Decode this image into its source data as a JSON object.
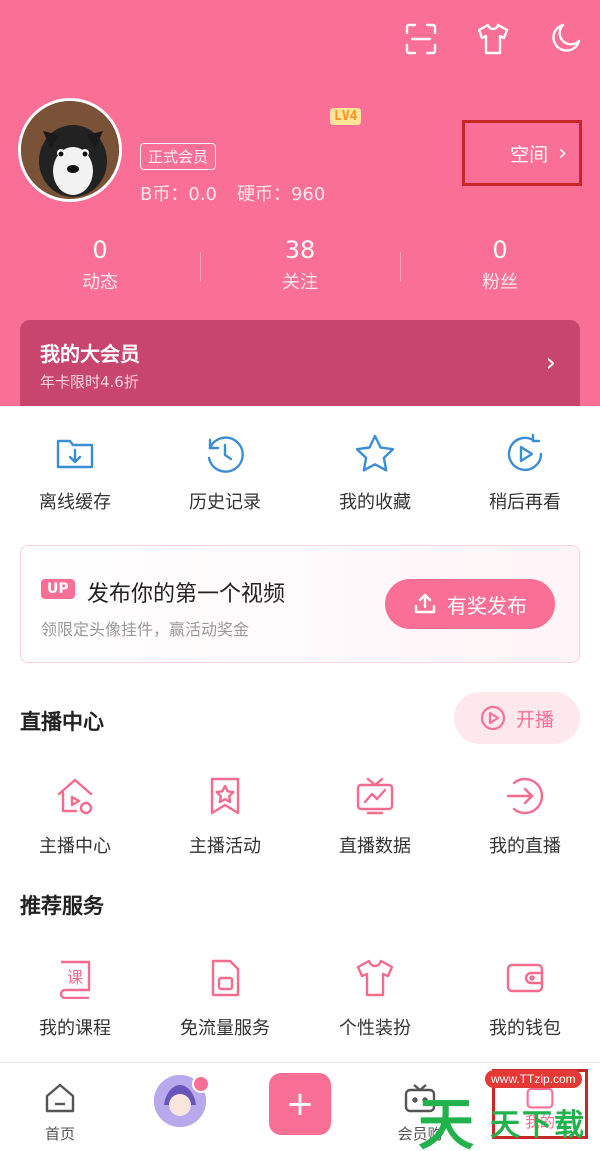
{
  "header": {
    "level": "LV4",
    "member_badge": "正式会员",
    "b_coins": "B币：0.0",
    "coins": "硬币：960",
    "space_label": "空间",
    "stats": [
      {
        "num": "0",
        "label": "动态"
      },
      {
        "num": "38",
        "label": "关注"
      },
      {
        "num": "0",
        "label": "粉丝"
      }
    ],
    "vip": {
      "title": "我的大会员",
      "subtitle": "年卡限时4.6折"
    }
  },
  "quick": [
    {
      "label": "离线缓存",
      "icon": "download-folder-icon"
    },
    {
      "label": "历史记录",
      "icon": "history-clock-icon"
    },
    {
      "label": "我的收藏",
      "icon": "star-icon"
    },
    {
      "label": "稍后再看",
      "icon": "watch-later-icon"
    }
  ],
  "upload": {
    "tag": "UP",
    "title": "发布你的第一个视频",
    "subtitle": "领限定头像挂件，赢活动奖金",
    "button": "有奖发布"
  },
  "live_section": {
    "title": "直播中心",
    "button": "开播",
    "items": [
      {
        "label": "主播中心",
        "icon": "anchor-home-icon"
      },
      {
        "label": "主播活动",
        "icon": "activity-star-icon"
      },
      {
        "label": "直播数据",
        "icon": "tv-chart-icon"
      },
      {
        "label": "我的直播",
        "icon": "enter-arrow-icon"
      }
    ]
  },
  "services": {
    "title": "推荐服务",
    "items": [
      {
        "label": "我的课程",
        "icon": "course-book-icon"
      },
      {
        "label": "免流量服务",
        "icon": "sim-card-icon"
      },
      {
        "label": "个性装扮",
        "icon": "tshirt-icon"
      },
      {
        "label": "我的钱包",
        "icon": "wallet-icon"
      }
    ]
  },
  "nav": [
    {
      "label": "首页"
    },
    {
      "label": ""
    },
    {
      "label": ""
    },
    {
      "label": "会员购"
    },
    {
      "label": "我的"
    }
  ],
  "watermark": {
    "url": "www.TTzip.com",
    "big": "天",
    "small": "天下载"
  },
  "colors": {
    "brand": "#f96f96",
    "vip_card": "#c8466e",
    "highlight_box": "#c62828"
  }
}
